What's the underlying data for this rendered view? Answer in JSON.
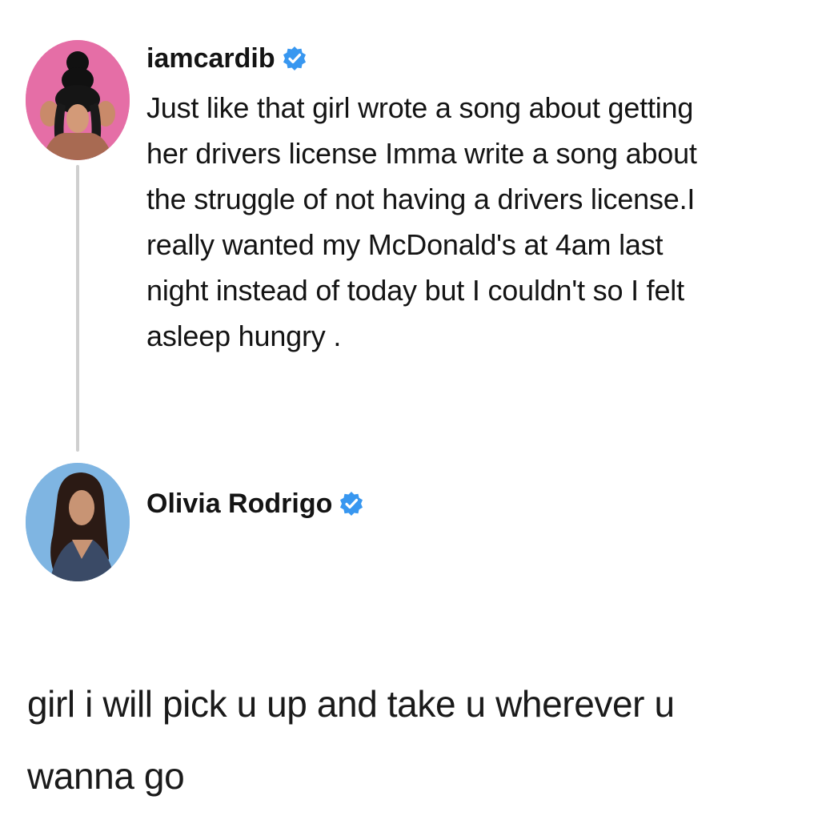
{
  "post": {
    "username": "iamcardib",
    "text": "Just like that girl wrote a song about getting\nher drivers license Imma write a song about\nthe struggle of not having a drivers license.I\nreally wanted my McDonald's at 4am last\nnight instead of today but I couldn't so I felt\nasleep hungry .",
    "verified_icon": "verified-badge-icon",
    "avatar_color": "#e56ea6"
  },
  "reply": {
    "username": "Olivia Rodrigo",
    "text": "girl i will pick u up and take u wherever u\nwanna go",
    "verified_icon": "verified-badge-icon",
    "avatar_color": "#7fb5e2"
  },
  "colors": {
    "verified_blue": "#3897f0",
    "thread_line": "#cfcfcf",
    "text": "#141414"
  }
}
